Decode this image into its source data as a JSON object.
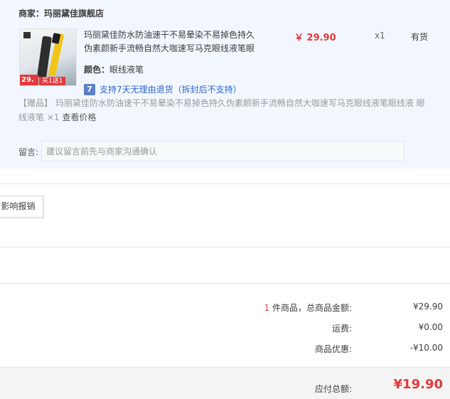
{
  "seller": {
    "label": "商家：",
    "name": "玛丽黛佳旗舰店"
  },
  "item": {
    "thumb": {
      "price_tag": "29.",
      "promo_tag": "买1送1"
    },
    "title": "玛丽黛佳防水防油速干不易晕染不易掉色持久伪素颜新手流畅自然大咖速写马克眼线液笔眼",
    "color_label": "颜色：",
    "color_value": "眼线液笔",
    "price": "￥ 29.90",
    "quantity": "x1",
    "stock": "有货",
    "return_icon": "7",
    "return_policy": "支持7天无理由退货（拆封后不支持）"
  },
  "gift": {
    "text": "【赠品】 玛丽黛佳防水防油速干不易晕染不易掉色持久伪素颜新手流畅自然大咖速写马克眼线液笔眼线液 眼线液笔 ×1",
    "price_link": "查看价格"
  },
  "message": {
    "label": "留言:",
    "placeholder": "建议留言前先与商家沟通确认"
  },
  "invoice": {
    "button_label": "影响报销"
  },
  "summary": {
    "count": "1",
    "count_label": " 件商品，总商品金额:",
    "goods_total": "¥29.90",
    "shipping_label": "运费:",
    "shipping": "¥0.00",
    "discount_label": "商品优惠:",
    "discount": "-¥10.00",
    "payable_label": "应付总额:",
    "payable": "¥19.90"
  },
  "colors": {
    "accent_red": "#e4393c",
    "panel_bg": "#f2f7ff",
    "link_blue": "#2f63c6"
  }
}
